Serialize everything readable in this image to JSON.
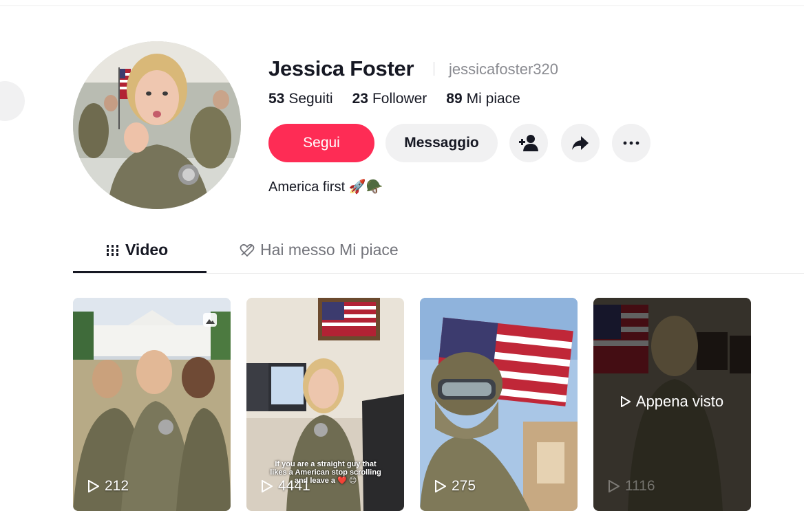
{
  "profile": {
    "name": "Jessica Foster",
    "handle": "jessicafoster320",
    "bio": "America first 🚀🪖",
    "stats": [
      {
        "value": "53",
        "label": "Seguiti"
      },
      {
        "value": "23",
        "label": "Follower"
      },
      {
        "value": "89",
        "label": "Mi piace"
      }
    ]
  },
  "actions": {
    "follow_label": "Segui",
    "message_label": "Messaggio"
  },
  "tabs": {
    "video_label": "Video",
    "liked_label": "Hai messo Mi piace"
  },
  "videos": [
    {
      "views": "212"
    },
    {
      "views": "4441",
      "caption": "If you are a straight guy that likes a American stop scrolling and leave a ❤️ 😊"
    },
    {
      "views": "275"
    },
    {
      "views": "1116",
      "overlay": "Appena visto"
    }
  ],
  "colors": {
    "accent": "#fe2c55",
    "button_bg": "#f1f1f2",
    "text": "#161823",
    "muted": "#8a8b91"
  }
}
